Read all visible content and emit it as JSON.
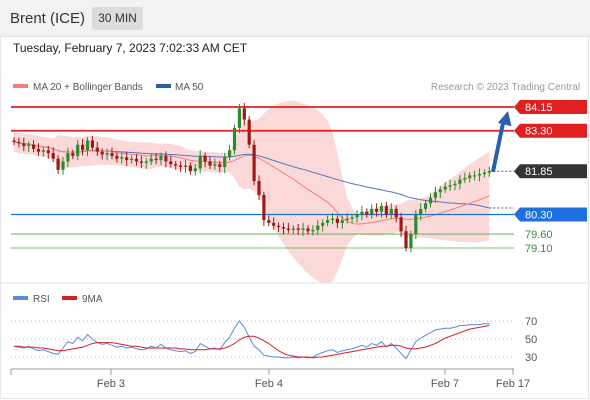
{
  "header": {
    "instrument": "Brent (ICE)",
    "timeframe": "30 MIN"
  },
  "timestamp": "Tuesday, February 7, 2023 7:02:33 AM CET",
  "legend": {
    "ma20": "MA 20 + Bollinger Bands",
    "ma50": "MA 50",
    "credit": "Research © 2023 Trading Central"
  },
  "rsi_legend": {
    "rsi": "RSI",
    "ma9": "9MA"
  },
  "colors": {
    "resistance": "#e02020",
    "support": "#1e6fe0",
    "minor_support": "#5aa64a",
    "current": "#333333",
    "candle_up": "#2d8a2d",
    "candle_down": "#a01818",
    "bollinger_fill": "#fbd9d9",
    "ma20": "#f08080",
    "ma50": "#5577bb",
    "arrow": "#2b5fa8",
    "rsi": "#5b8ad6",
    "rsi_ma": "#d42020"
  },
  "chart_data": [
    {
      "type": "candlestick",
      "title": "Brent (ICE)",
      "timeframe": "30 MIN",
      "x_ticks": [
        "Feb 3",
        "Feb 4",
        "Feb 7",
        "Feb 17"
      ],
      "levels": [
        {
          "label": "84.15",
          "value": 84.15,
          "kind": "resistance"
        },
        {
          "label": "83.30",
          "value": 83.3,
          "kind": "resistance"
        },
        {
          "label": "81.85",
          "value": 81.85,
          "kind": "current"
        },
        {
          "label": "80.30",
          "value": 80.3,
          "kind": "support"
        },
        {
          "label": "79.60",
          "value": 79.6,
          "kind": "minor-support"
        },
        {
          "label": "79.10",
          "value": 79.1,
          "kind": "minor-support"
        }
      ],
      "target": 84.15,
      "series": [
        {
          "name": "MA 20 + Bollinger Bands"
        },
        {
          "name": "MA 50"
        }
      ],
      "ylim": [
        78.0,
        85.0
      ],
      "close": [
        82.9,
        82.85,
        82.75,
        82.8,
        82.65,
        82.55,
        82.6,
        82.5,
        82.3,
        81.9,
        82.2,
        82.5,
        82.4,
        82.8,
        82.6,
        82.95,
        82.7,
        82.55,
        82.45,
        82.5,
        82.4,
        82.3,
        82.35,
        82.25,
        82.3,
        82.2,
        82.15,
        82.2,
        82.3,
        82.25,
        82.4,
        82.2,
        82.1,
        82.05,
        82.0,
        82.05,
        81.85,
        81.95,
        82.4,
        82.2,
        82.05,
        82.1,
        82.0,
        82.35,
        82.6,
        83.4,
        84.1,
        83.7,
        82.8,
        81.5,
        81.0,
        80.1,
        80.0,
        79.9,
        79.85,
        79.8,
        79.75,
        79.8,
        79.75,
        79.8,
        79.7,
        79.75,
        79.9,
        80.0,
        80.1,
        80.15,
        80.0,
        80.1,
        80.15,
        80.2,
        80.3,
        80.4,
        80.3,
        80.5,
        80.4,
        80.6,
        80.3,
        80.5,
        80.2,
        79.7,
        79.1,
        79.6,
        80.3,
        80.5,
        80.7,
        80.9,
        81.1,
        81.2,
        81.3,
        81.35,
        81.4,
        81.55,
        81.6,
        81.7,
        81.7,
        81.75,
        81.8,
        81.85
      ]
    },
    {
      "type": "line",
      "title": "RSI",
      "series": [
        {
          "name": "RSI"
        },
        {
          "name": "9MA"
        }
      ],
      "y_ticks": [
        70,
        50,
        30
      ],
      "ylim": [
        20,
        80
      ],
      "rsi": [
        42,
        41,
        40,
        42,
        39,
        37,
        38,
        36,
        34,
        33,
        40,
        47,
        45,
        52,
        48,
        55,
        50,
        46,
        44,
        45,
        43,
        41,
        42,
        40,
        41,
        39,
        38,
        39,
        42,
        40,
        44,
        40,
        38,
        37,
        36,
        37,
        34,
        36,
        45,
        42,
        39,
        40,
        38,
        46,
        52,
        62,
        70,
        63,
        52,
        42,
        38,
        32,
        31,
        30,
        30,
        29,
        29,
        30,
        29,
        30,
        29,
        30,
        33,
        35,
        37,
        38,
        35,
        37,
        38,
        39,
        41,
        43,
        41,
        45,
        43,
        47,
        41,
        45,
        40,
        34,
        28,
        38,
        47,
        51,
        54,
        57,
        60,
        61,
        62,
        62,
        63,
        65,
        65,
        66,
        66,
        66,
        67,
        67
      ],
      "rsi_ma": [
        42,
        42,
        41,
        41,
        41,
        40,
        40,
        39,
        38,
        37,
        37,
        38,
        39,
        40,
        41,
        43,
        45,
        46,
        46,
        46,
        46,
        45,
        44,
        43,
        42,
        42,
        41,
        40,
        40,
        40,
        40,
        40,
        40,
        40,
        39,
        39,
        38,
        38,
        38,
        38,
        39,
        39,
        39,
        40,
        42,
        45,
        49,
        52,
        53,
        53,
        51,
        48,
        45,
        41,
        37,
        34,
        32,
        31,
        30,
        30,
        30,
        29,
        30,
        30,
        31,
        32,
        33,
        34,
        35,
        36,
        37,
        38,
        39,
        40,
        41,
        42,
        42,
        43,
        43,
        42,
        40,
        39,
        39,
        40,
        41,
        43,
        45,
        48,
        51,
        53,
        55,
        57,
        59,
        61,
        62,
        63,
        64,
        65
      ]
    }
  ]
}
